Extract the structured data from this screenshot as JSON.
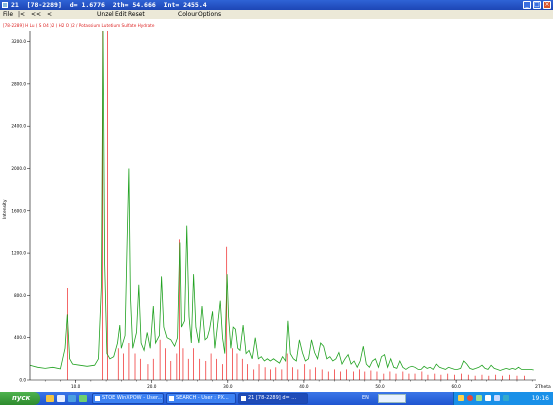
{
  "window": {
    "title": "21  [78-2289]  d= 1.6776  2th= 54.666  Int= 2455.4"
  },
  "menu": {
    "items": [
      "File",
      "|<",
      "<<",
      "<",
      "Unzel",
      "Edit",
      "Reset",
      "Colour",
      "Options"
    ]
  },
  "plot": {
    "reference_label": "[78-2289] H Lu ( S O4 )2 ( H2 O )2 / Potassium Lutetium Sulfate Hydrate",
    "ylabel": "Intensity",
    "xlabel": "2Theta",
    "y_ticks": [
      "0.0",
      "400.0",
      "800.0",
      "1200.0",
      "1600.0",
      "2000.0",
      "2400.0",
      "2800.0",
      "3200.0"
    ],
    "x_ticks": [
      "10.0",
      "20.0",
      "30.0",
      "40.0",
      "50.0",
      "60.0"
    ],
    "colors": {
      "pattern": "#22a222",
      "reference": "#ee2222",
      "axis": "#000000",
      "label": "#dd2222"
    }
  },
  "chart_data": {
    "type": "line",
    "xlim": [
      4,
      70.5
    ],
    "ylim": [
      0,
      3300
    ],
    "ylabel": "Intensity",
    "xlabel": "2Theta",
    "series": [
      {
        "name": "pattern",
        "points": [
          [
            4.0,
            140
          ],
          [
            5.0,
            120
          ],
          [
            6.0,
            110
          ],
          [
            7.0,
            120
          ],
          [
            8.0,
            105
          ],
          [
            8.6,
            300
          ],
          [
            8.9,
            620
          ],
          [
            9.2,
            200
          ],
          [
            9.6,
            150
          ],
          [
            10.5,
            140
          ],
          [
            11.5,
            130
          ],
          [
            12.5,
            140
          ],
          [
            13.0,
            200
          ],
          [
            13.4,
            900
          ],
          [
            13.6,
            3300
          ],
          [
            13.8,
            1100
          ],
          [
            14.1,
            250
          ],
          [
            14.5,
            200
          ],
          [
            15.0,
            220
          ],
          [
            15.5,
            350
          ],
          [
            15.8,
            520
          ],
          [
            16.0,
            300
          ],
          [
            16.5,
            420
          ],
          [
            16.8,
            1400
          ],
          [
            17.0,
            2000
          ],
          [
            17.2,
            800
          ],
          [
            17.5,
            300
          ],
          [
            18.0,
            450
          ],
          [
            18.3,
            900
          ],
          [
            18.6,
            350
          ],
          [
            19.0,
            280
          ],
          [
            19.4,
            450
          ],
          [
            19.8,
            300
          ],
          [
            20.2,
            700
          ],
          [
            20.5,
            350
          ],
          [
            21.0,
            420
          ],
          [
            21.3,
            980
          ],
          [
            21.6,
            500
          ],
          [
            22.0,
            400
          ],
          [
            22.5,
            380
          ],
          [
            23.0,
            320
          ],
          [
            23.4,
            400
          ],
          [
            23.7,
            1300
          ],
          [
            23.9,
            500
          ],
          [
            24.3,
            560
          ],
          [
            24.6,
            1460
          ],
          [
            24.9,
            600
          ],
          [
            25.2,
            350
          ],
          [
            25.5,
            1000
          ],
          [
            25.8,
            500
          ],
          [
            26.2,
            350
          ],
          [
            26.6,
            700
          ],
          [
            27.0,
            380
          ],
          [
            27.3,
            400
          ],
          [
            27.6,
            480
          ],
          [
            28.0,
            650
          ],
          [
            28.3,
            300
          ],
          [
            28.7,
            550
          ],
          [
            29.0,
            750
          ],
          [
            29.3,
            400
          ],
          [
            29.6,
            250
          ],
          [
            29.9,
            1000
          ],
          [
            30.1,
            600
          ],
          [
            30.4,
            300
          ],
          [
            30.7,
            500
          ],
          [
            31.0,
            480
          ],
          [
            31.3,
            300
          ],
          [
            31.6,
            280
          ],
          [
            32.0,
            520
          ],
          [
            32.4,
            250
          ],
          [
            32.8,
            280
          ],
          [
            33.2,
            200
          ],
          [
            33.6,
            400
          ],
          [
            34.0,
            200
          ],
          [
            34.4,
            220
          ],
          [
            34.8,
            180
          ],
          [
            35.2,
            200
          ],
          [
            35.6,
            180
          ],
          [
            36.0,
            200
          ],
          [
            36.4,
            180
          ],
          [
            36.8,
            160
          ],
          [
            37.2,
            220
          ],
          [
            37.6,
            180
          ],
          [
            37.9,
            560
          ],
          [
            38.2,
            250
          ],
          [
            38.6,
            200
          ],
          [
            39.0,
            180
          ],
          [
            39.4,
            380
          ],
          [
            39.8,
            260
          ],
          [
            40.2,
            180
          ],
          [
            40.6,
            200
          ],
          [
            41.0,
            380
          ],
          [
            41.4,
            260
          ],
          [
            41.8,
            200
          ],
          [
            42.2,
            350
          ],
          [
            42.6,
            320
          ],
          [
            43.0,
            200
          ],
          [
            43.4,
            220
          ],
          [
            43.8,
            180
          ],
          [
            44.2,
            200
          ],
          [
            44.6,
            260
          ],
          [
            45.0,
            150
          ],
          [
            45.4,
            200
          ],
          [
            45.8,
            240
          ],
          [
            46.2,
            150
          ],
          [
            46.6,
            180
          ],
          [
            47.0,
            120
          ],
          [
            47.4,
            180
          ],
          [
            47.8,
            320
          ],
          [
            48.2,
            150
          ],
          [
            48.6,
            120
          ],
          [
            49.0,
            180
          ],
          [
            49.4,
            200
          ],
          [
            49.8,
            120
          ],
          [
            50.2,
            220
          ],
          [
            50.6,
            240
          ],
          [
            51.0,
            120
          ],
          [
            51.4,
            200
          ],
          [
            51.8,
            120
          ],
          [
            52.2,
            110
          ],
          [
            52.6,
            180
          ],
          [
            53.0,
            120
          ],
          [
            53.4,
            100
          ],
          [
            53.8,
            120
          ],
          [
            54.2,
            130
          ],
          [
            54.6,
            120
          ],
          [
            55.0,
            100
          ],
          [
            55.4,
            100
          ],
          [
            55.8,
            130
          ],
          [
            56.2,
            110
          ],
          [
            56.6,
            120
          ],
          [
            57.0,
            100
          ],
          [
            57.4,
            150
          ],
          [
            57.8,
            120
          ],
          [
            58.2,
            110
          ],
          [
            58.6,
            100
          ],
          [
            59.0,
            120
          ],
          [
            59.4,
            110
          ],
          [
            59.8,
            100
          ],
          [
            60.2,
            100
          ],
          [
            60.6,
            110
          ],
          [
            61.0,
            180
          ],
          [
            61.4,
            150
          ],
          [
            61.8,
            110
          ],
          [
            62.2,
            100
          ],
          [
            62.6,
            110
          ],
          [
            63.0,
            120
          ],
          [
            63.4,
            140
          ],
          [
            63.8,
            110
          ],
          [
            64.2,
            100
          ],
          [
            64.6,
            140
          ],
          [
            65.0,
            110
          ],
          [
            65.4,
            100
          ],
          [
            65.8,
            90
          ],
          [
            66.2,
            100
          ],
          [
            66.6,
            110
          ],
          [
            67.0,
            100
          ],
          [
            67.4,
            110
          ],
          [
            67.8,
            100
          ],
          [
            68.2,
            120
          ],
          [
            68.6,
            100
          ],
          [
            69.0,
            100
          ],
          [
            69.4,
            100
          ],
          [
            69.8,
            100
          ],
          [
            70.2,
            95
          ]
        ]
      },
      {
        "name": "reference",
        "sticks": [
          [
            8.95,
            870
          ],
          [
            13.55,
            3300
          ],
          [
            14.2,
            3300
          ],
          [
            15.6,
            300
          ],
          [
            16.3,
            250
          ],
          [
            17.0,
            350
          ],
          [
            17.8,
            250
          ],
          [
            18.5,
            200
          ],
          [
            19.5,
            150
          ],
          [
            20.2,
            200
          ],
          [
            21.1,
            380
          ],
          [
            21.8,
            300
          ],
          [
            22.5,
            180
          ],
          [
            23.3,
            250
          ],
          [
            23.65,
            1330
          ],
          [
            24.1,
            300
          ],
          [
            24.8,
            200
          ],
          [
            25.5,
            300
          ],
          [
            26.3,
            200
          ],
          [
            27.1,
            180
          ],
          [
            27.8,
            250
          ],
          [
            28.5,
            200
          ],
          [
            29.3,
            150
          ],
          [
            29.85,
            1260
          ],
          [
            30.6,
            300
          ],
          [
            31.2,
            250
          ],
          [
            31.9,
            200
          ],
          [
            32.6,
            150
          ],
          [
            33.4,
            100
          ],
          [
            34.1,
            150
          ],
          [
            34.9,
            120
          ],
          [
            35.6,
            100
          ],
          [
            36.3,
            120
          ],
          [
            37.1,
            100
          ],
          [
            37.8,
            250
          ],
          [
            38.5,
            120
          ],
          [
            39.2,
            100
          ],
          [
            40.1,
            150
          ],
          [
            40.8,
            100
          ],
          [
            41.5,
            120
          ],
          [
            42.4,
            100
          ],
          [
            43.2,
            80
          ],
          [
            44.0,
            100
          ],
          [
            44.8,
            80
          ],
          [
            45.6,
            100
          ],
          [
            46.5,
            80
          ],
          [
            47.3,
            100
          ],
          [
            48.0,
            80
          ],
          [
            48.8,
            90
          ],
          [
            49.6,
            80
          ],
          [
            50.5,
            60
          ],
          [
            51.3,
            80
          ],
          [
            52.1,
            60
          ],
          [
            53.0,
            80
          ],
          [
            53.8,
            60
          ],
          [
            54.6,
            60
          ],
          [
            55.5,
            80
          ],
          [
            56.3,
            50
          ],
          [
            57.2,
            60
          ],
          [
            58.0,
            50
          ],
          [
            58.9,
            60
          ],
          [
            59.8,
            50
          ],
          [
            60.7,
            60
          ],
          [
            61.6,
            50
          ],
          [
            62.5,
            40
          ],
          [
            63.4,
            50
          ],
          [
            64.3,
            40
          ],
          [
            65.2,
            50
          ],
          [
            66.1,
            40
          ],
          [
            67.0,
            50
          ],
          [
            68.0,
            40
          ],
          [
            69.0,
            40
          ]
        ]
      }
    ]
  },
  "taskbar": {
    "start_label": "пуск",
    "tasks": [
      "STOE WinXPOW - User...",
      "SEARCH - User : PX...",
      "21  [78-2289]  d= ..."
    ],
    "language": "EN",
    "clock": "19:16"
  }
}
